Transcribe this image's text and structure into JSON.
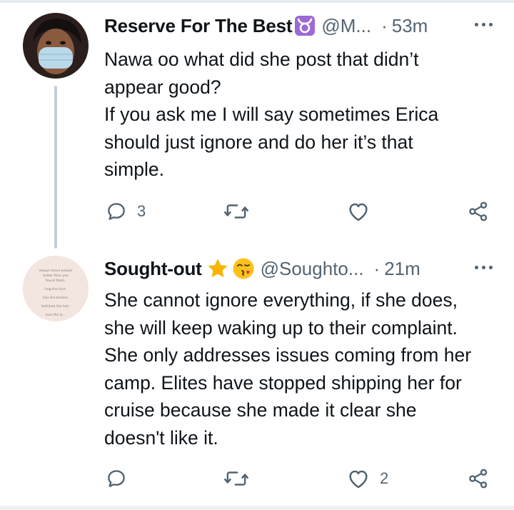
{
  "tweets": [
    {
      "name": "Reserve For The Best",
      "name_emoji": "taurus-sign",
      "handle": "@M...",
      "separator": "·",
      "time": "53m",
      "lines": [
        "Nawa oo what did she post that didn’t",
        "appear good?",
        "If you ask me I will say sometimes Erica",
        "should just ignore and do her it’s that",
        "simple."
      ],
      "actions": {
        "reply_count": "3",
        "retweet_count": "",
        "like_count": ""
      }
    },
    {
      "name": "Sought-out",
      "name_emoji": "star, face-blowing-a-kiss",
      "handle": "@Soughto...",
      "separator": "·",
      "time": "21m",
      "lines": [
        "She cannot ignore everything, if she does,",
        "she will keep waking up to their complaint.",
        "She only addresses issues coming from her",
        "camp. Elites have stopped shipping her for",
        "cruise because she made it clear she",
        "doesn't like it."
      ],
      "actions": {
        "reply_count": "",
        "retweet_count": "",
        "like_count": "2"
      },
      "avatar_text": [
        "always leave people",
        "better than you",
        "found them.",
        "hug the hurt.",
        "kiss the broken.",
        "befriend the lost.",
        "love the lo..."
      ]
    }
  ],
  "colors": {
    "text": "#0f1419",
    "muted": "#536471",
    "thread": "#c4cfd6",
    "taurus": "#9b6ad4",
    "star": "#f7b500"
  }
}
